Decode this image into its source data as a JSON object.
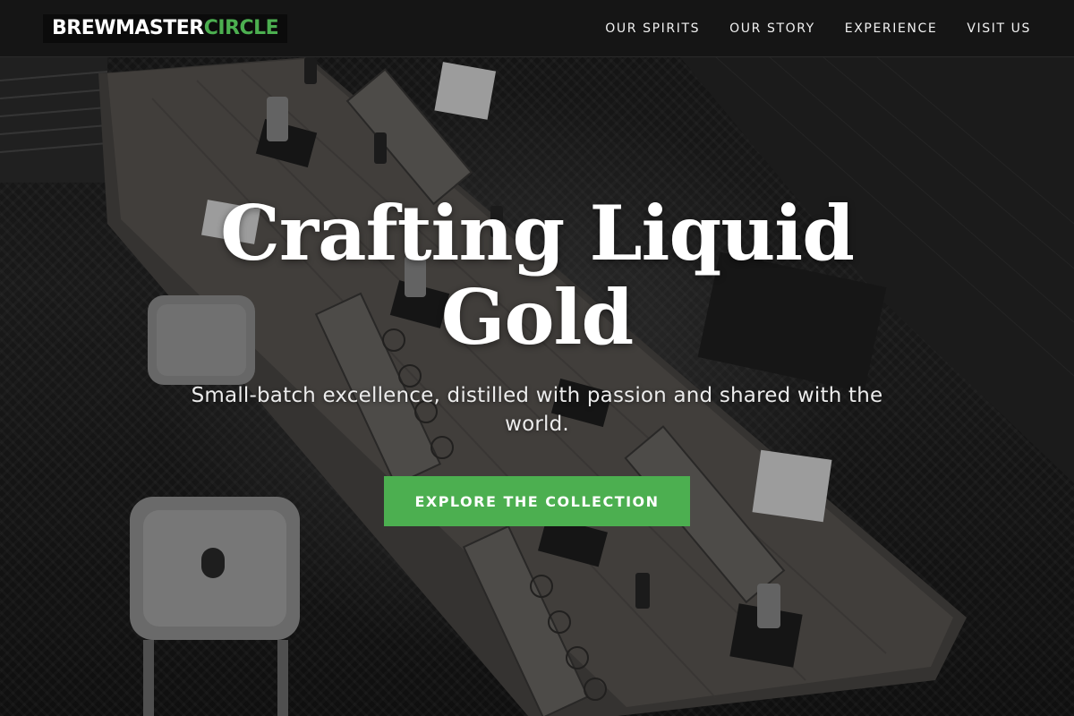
{
  "brand": {
    "name_part1": "BREWMASTER",
    "name_part2": "CIRCLE",
    "accent_color": "#4caf50"
  },
  "nav": {
    "items": [
      {
        "label": "OUR SPIRITS"
      },
      {
        "label": "OUR STORY"
      },
      {
        "label": "EXPERIENCE"
      },
      {
        "label": "VISIT US"
      }
    ]
  },
  "hero": {
    "title_line1": "Crafting Liquid",
    "title_line2": "Gold",
    "subtitle": "Small-batch excellence, distilled with passion and shared with the world.",
    "cta_label": "EXPLORE THE COLLECTION",
    "background": "tasting-room-photo"
  }
}
